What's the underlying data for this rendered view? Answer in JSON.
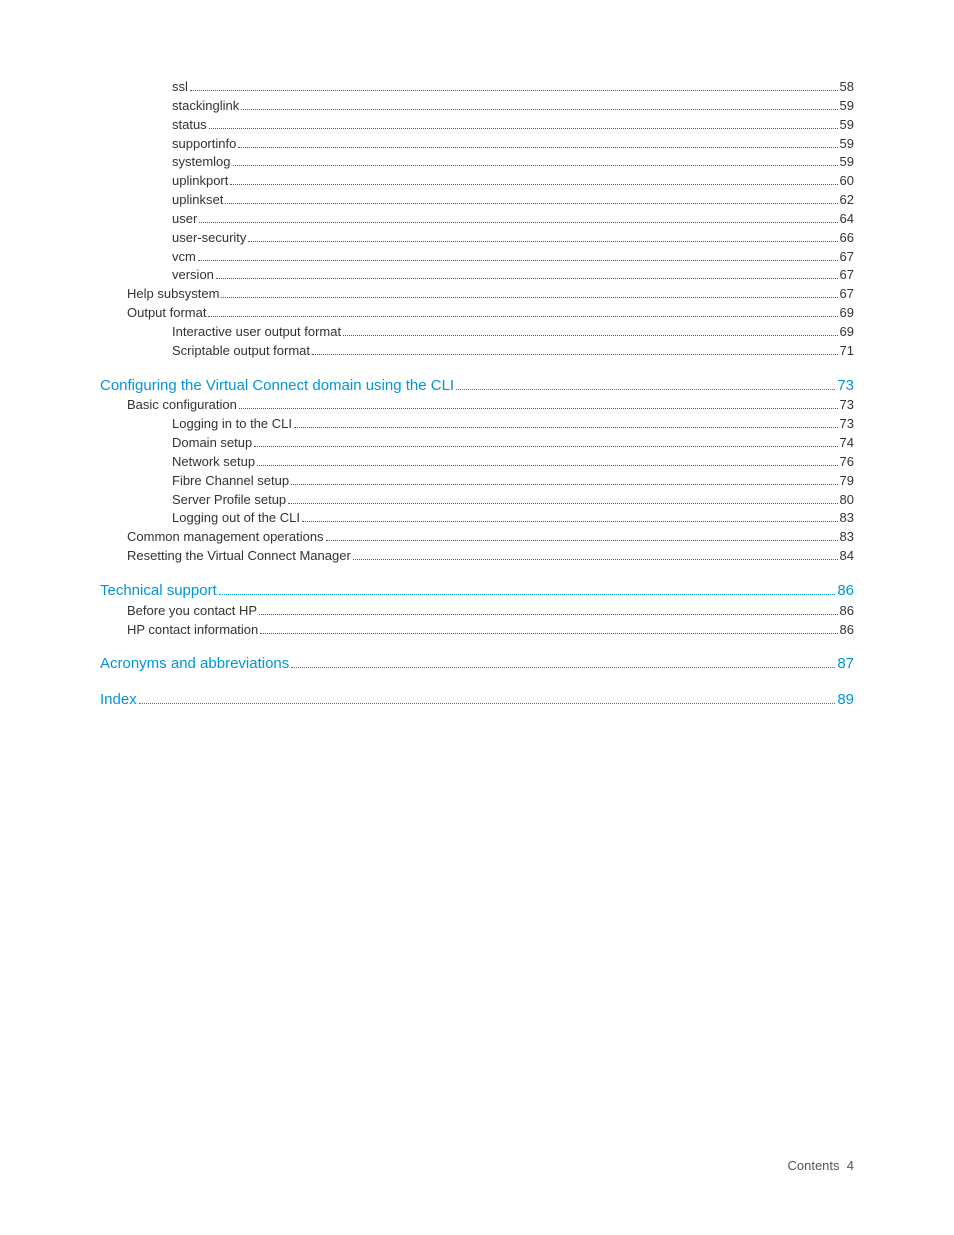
{
  "sections": [
    {
      "entries": [
        {
          "level": 3,
          "label": "ssl",
          "page": "58",
          "heading": false,
          "interact": true
        },
        {
          "level": 3,
          "label": "stackinglink",
          "page": "59",
          "heading": false,
          "interact": true
        },
        {
          "level": 3,
          "label": "status",
          "page": "59",
          "heading": false,
          "interact": true
        },
        {
          "level": 3,
          "label": "supportinfo",
          "page": "59",
          "heading": false,
          "interact": true
        },
        {
          "level": 3,
          "label": "systemlog",
          "page": "59",
          "heading": false,
          "interact": true
        },
        {
          "level": 3,
          "label": "uplinkport",
          "page": "60",
          "heading": false,
          "interact": true
        },
        {
          "level": 3,
          "label": "uplinkset",
          "page": "62",
          "heading": false,
          "interact": true
        },
        {
          "level": 3,
          "label": "user",
          "page": "64",
          "heading": false,
          "interact": true
        },
        {
          "level": 3,
          "label": "user-security",
          "page": "66",
          "heading": false,
          "interact": true
        },
        {
          "level": 3,
          "label": "vcm",
          "page": "67",
          "heading": false,
          "interact": true
        },
        {
          "level": 3,
          "label": "version",
          "page": "67",
          "heading": false,
          "interact": true
        },
        {
          "level": 2,
          "label": "Help subsystem",
          "page": "67",
          "heading": false,
          "interact": true
        },
        {
          "level": 2,
          "label": "Output format",
          "page": "69",
          "heading": false,
          "interact": true
        },
        {
          "level": 3,
          "label": "Interactive user output format",
          "page": "69",
          "heading": false,
          "interact": true
        },
        {
          "level": 3,
          "label": "Scriptable output format",
          "page": "71",
          "heading": false,
          "interact": true
        }
      ]
    },
    {
      "entries": [
        {
          "level": 1,
          "label": "Configuring the Virtual Connect domain using the CLI",
          "page": "73",
          "heading": true,
          "interact": true
        },
        {
          "level": 2,
          "label": "Basic configuration",
          "page": "73",
          "heading": false,
          "interact": true
        },
        {
          "level": 3,
          "label": "Logging in to the CLI",
          "page": "73",
          "heading": false,
          "interact": true
        },
        {
          "level": 3,
          "label": "Domain setup",
          "page": "74",
          "heading": false,
          "interact": true
        },
        {
          "level": 3,
          "label": "Network setup",
          "page": "76",
          "heading": false,
          "interact": true
        },
        {
          "level": 3,
          "label": "Fibre Channel setup",
          "page": "79",
          "heading": false,
          "interact": true
        },
        {
          "level": 3,
          "label": "Server Profile setup",
          "page": "80",
          "heading": false,
          "interact": true
        },
        {
          "level": 3,
          "label": "Logging out of the CLI",
          "page": "83",
          "heading": false,
          "interact": true
        },
        {
          "level": 2,
          "label": "Common management operations",
          "page": "83",
          "heading": false,
          "interact": true
        },
        {
          "level": 2,
          "label": "Resetting the Virtual Connect Manager",
          "page": "84",
          "heading": false,
          "interact": true
        }
      ]
    },
    {
      "entries": [
        {
          "level": 1,
          "label": "Technical support",
          "page": "86",
          "heading": true,
          "interact": true
        },
        {
          "level": 2,
          "label": "Before you contact HP",
          "page": "86",
          "heading": false,
          "interact": true
        },
        {
          "level": 2,
          "label": "HP contact information",
          "page": "86",
          "heading": false,
          "interact": true
        }
      ]
    },
    {
      "entries": [
        {
          "level": 1,
          "label": "Acronyms and abbreviations",
          "page": "87",
          "heading": true,
          "interact": true
        }
      ]
    },
    {
      "entries": [
        {
          "level": 1,
          "label": "Index",
          "page": "89",
          "heading": true,
          "interact": true
        }
      ]
    }
  ],
  "footer": {
    "label": "Contents",
    "page": "4"
  }
}
